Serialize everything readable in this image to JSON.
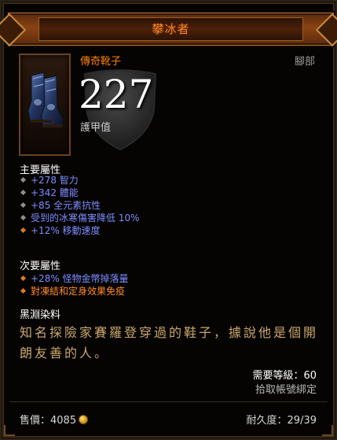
{
  "header": {
    "item_name": "攀冰者"
  },
  "item": {
    "type": "傳奇靴子",
    "slot": "腳部",
    "armor_value": "227",
    "armor_label": "護甲值",
    "icon": "armored-boots-icon"
  },
  "primary": {
    "title": "主要屬性",
    "props": [
      "+278 智力",
      "+342 體能",
      "+85 全元素抗性",
      "受到的冰寒傷害降低 10%",
      "+12% 移動速度"
    ]
  },
  "secondary": {
    "title": "次要屬性",
    "props": [
      "+28% 怪物金幣掉落量",
      "對凍結和定身效果免疫"
    ]
  },
  "dye": {
    "title": "黑淵染料"
  },
  "flavor": {
    "text": "知名探險家賽羅登穿過的鞋子，據說他是個開朗友善的人。"
  },
  "requirements": {
    "level": "需要等級：60",
    "bind": "拾取帳號綁定"
  },
  "footer": {
    "sell_label": "售價：4085",
    "durability": "耐久度：29/39"
  },
  "colors": {
    "legendary": "#ff8000",
    "magic_blue": "#7f8cff",
    "flavor_gold": "#c9a76e"
  }
}
